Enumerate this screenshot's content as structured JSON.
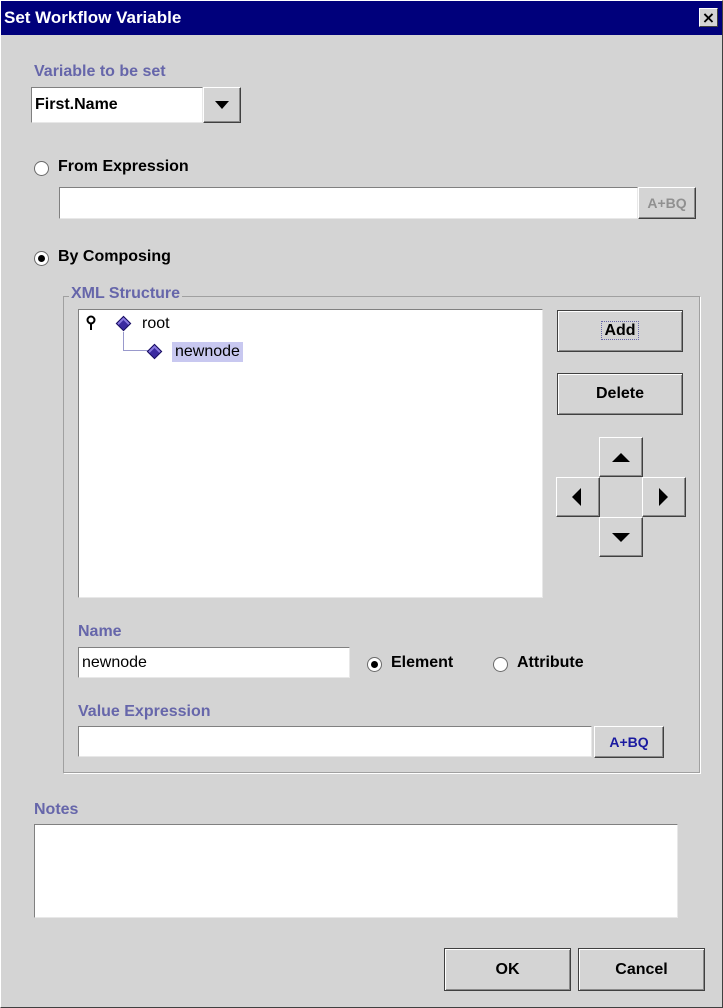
{
  "window": {
    "title": "Set Workflow Variable",
    "close_icon": "×"
  },
  "variable": {
    "label": "Variable to be set",
    "selected": "First.Name"
  },
  "from_expression": {
    "label": "From Expression",
    "selected": false,
    "value": "",
    "expr_button_label": "A+BQ"
  },
  "by_composing": {
    "label": "By Composing",
    "selected": true
  },
  "xml_structure": {
    "legend": "XML Structure",
    "tree": [
      {
        "label": "root",
        "level": 0
      },
      {
        "label": "newnode",
        "level": 1,
        "selected": true
      }
    ],
    "add_label": "Add",
    "delete_label": "Delete"
  },
  "name": {
    "label": "Name",
    "value": "newnode",
    "element_label": "Element",
    "attribute_label": "Attribute",
    "type_selected": "Element"
  },
  "value_expression": {
    "label": "Value Expression",
    "value": "",
    "expr_button_label": "A+BQ"
  },
  "notes": {
    "label": "Notes",
    "value": ""
  },
  "footer": {
    "ok_label": "OK",
    "cancel_label": "Cancel"
  },
  "colors": {
    "title_bar": "#00007b",
    "label": "#6666aa",
    "selection": "#c8c8f0",
    "node_icon": "#3a2aa0"
  },
  "icons": {
    "close": "close-icon",
    "dropdown": "chevron-down-icon",
    "expression_builder": "expression-builder-icon",
    "tree_key": "key-icon",
    "node": "diamond-node-icon",
    "move_up": "arrow-up-icon",
    "move_down": "arrow-down-icon",
    "move_left": "arrow-left-icon",
    "move_right": "arrow-right-icon"
  }
}
